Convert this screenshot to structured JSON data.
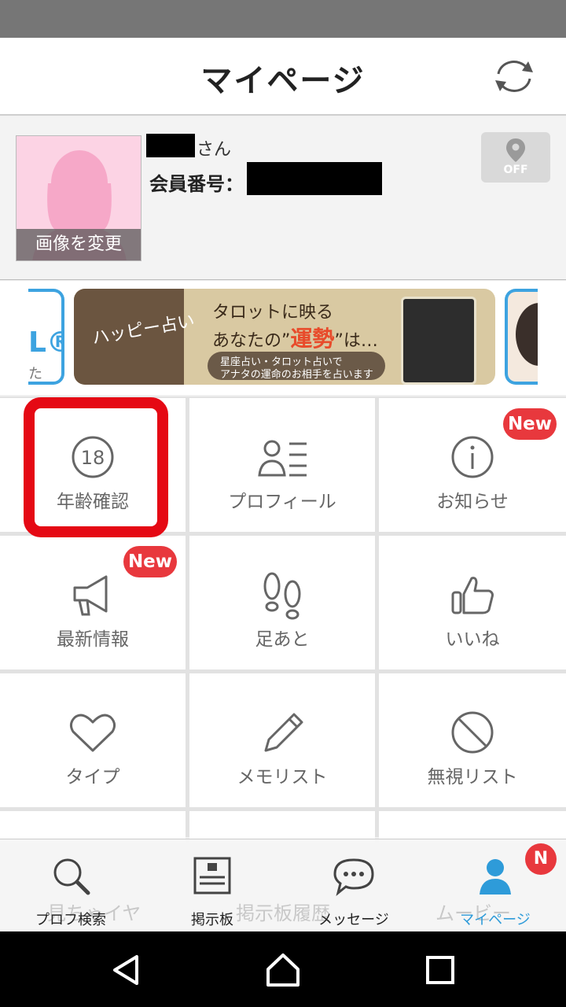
{
  "header": {
    "title": "マイページ"
  },
  "profile": {
    "avatar_change_label": "画像を変更",
    "name_suffix": "さん",
    "member_number_label": "会員番号：",
    "location_toggle_label": "OFF"
  },
  "banner": {
    "brand": "ハッピー占い",
    "line1": "タロットに映る",
    "line2_prefix": "あなたの",
    "line2_highlight": "運勢",
    "line2_suffix": "は…",
    "sub1": "星座占い・タロット占いで",
    "sub2": "アナタの運命のお相手を占います",
    "left_partial_top": "L®",
    "left_partial_bottom": "た"
  },
  "menu": {
    "items": [
      {
        "label": "年齢確認",
        "icon": "age-18-icon"
      },
      {
        "label": "プロフィール",
        "icon": "profile-list-icon"
      },
      {
        "label": "お知らせ",
        "icon": "info-icon",
        "badge": "New"
      },
      {
        "label": "最新情報",
        "icon": "megaphone-icon",
        "badge": "New"
      },
      {
        "label": "足あと",
        "icon": "footprints-icon"
      },
      {
        "label": "いいね",
        "icon": "thumbs-up-icon"
      },
      {
        "label": "タイプ",
        "icon": "heart-icon"
      },
      {
        "label": "メモリスト",
        "icon": "pencil-icon"
      },
      {
        "label": "無視リスト",
        "icon": "block-icon"
      }
    ],
    "hidden_row": [
      "見ちゃイヤ",
      "掲示板履歴",
      "ムービー"
    ]
  },
  "tabs": [
    {
      "label": "プロフ検索",
      "icon": "search-icon"
    },
    {
      "label": "掲示板",
      "icon": "board-icon"
    },
    {
      "label": "メッセージ",
      "icon": "chat-icon"
    },
    {
      "label": "マイページ",
      "icon": "person-icon",
      "badge": "N"
    }
  ],
  "colors": {
    "accent": "#2e9bd9",
    "badge_red": "#e8383d",
    "highlight_red": "#e50914"
  }
}
